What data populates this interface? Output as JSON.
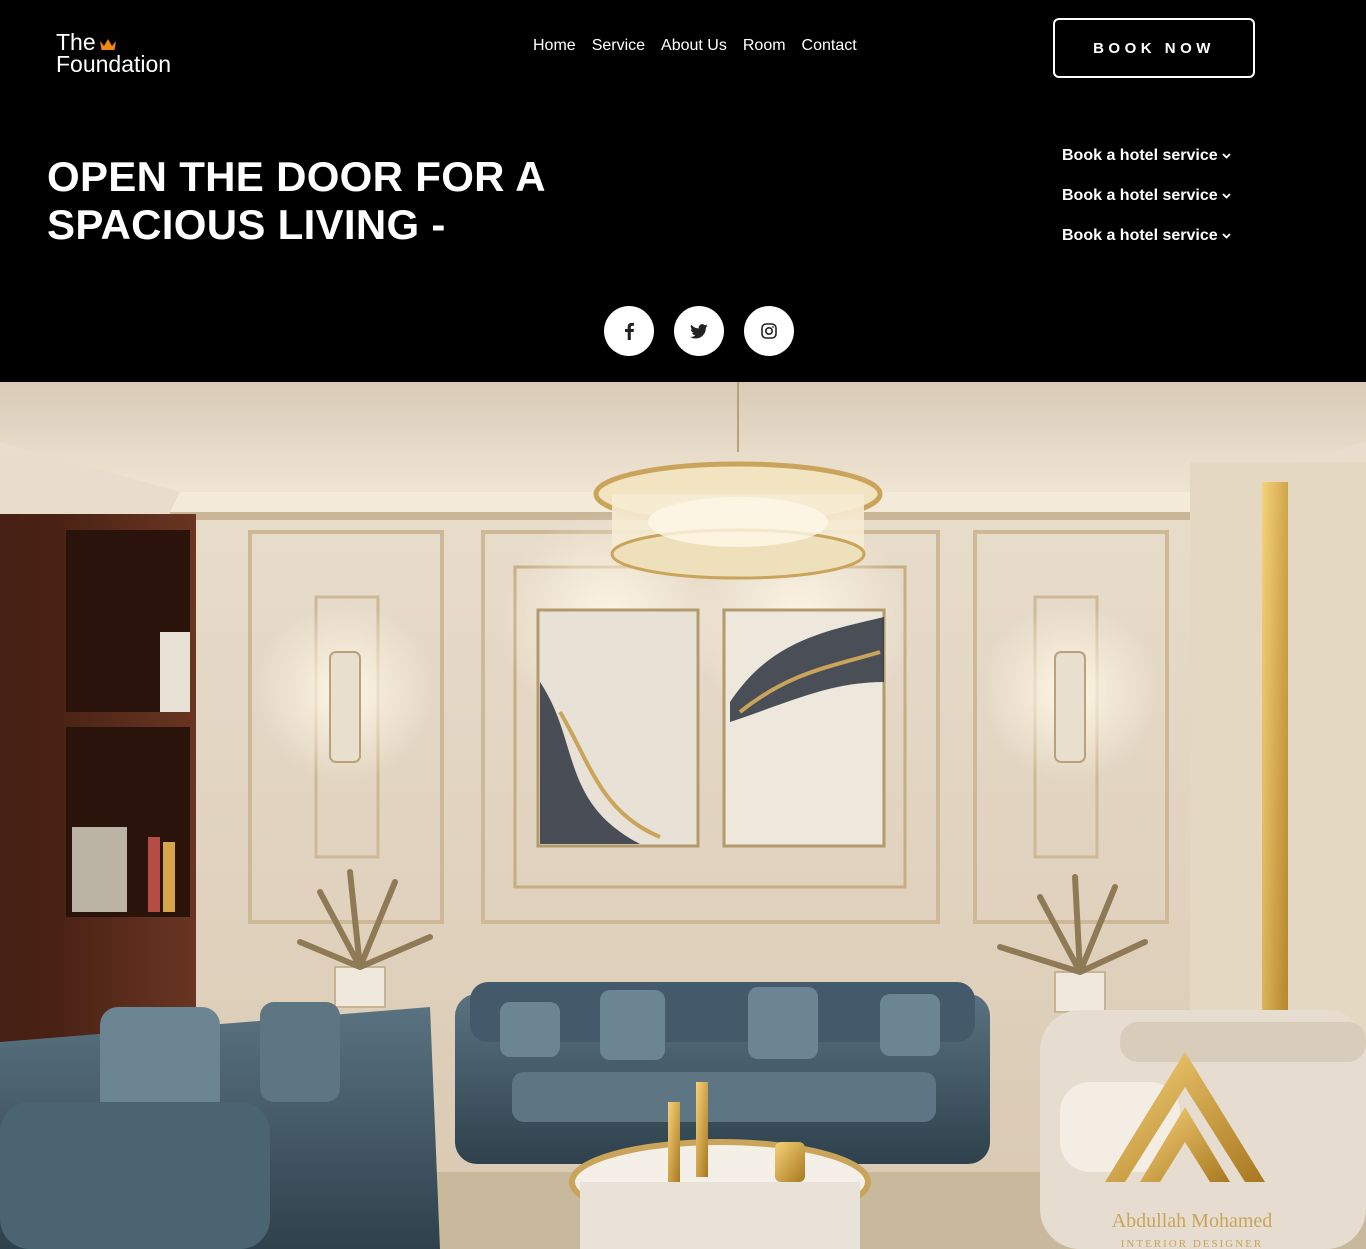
{
  "brand": {
    "line1": "The",
    "line2": "Foundation",
    "accent": "#f08a12"
  },
  "nav": {
    "items": [
      "Home",
      "Service",
      "About Us",
      "Room",
      "Contact"
    ]
  },
  "cta": {
    "label": "BOOK NOW"
  },
  "hero_title": {
    "line1": "OPEN THE DOOR FOR A",
    "line2": "SPACIOUS LIVING -"
  },
  "services": [
    "Book a hotel service",
    "Book a hotel service",
    "Book a hotel service"
  ],
  "socials": [
    "facebook-icon",
    "twitter-icon",
    "instagram-icon"
  ],
  "watermark": {
    "name": "Abdullah Mohamed",
    "role": "INTERIOR DESIGNER"
  }
}
